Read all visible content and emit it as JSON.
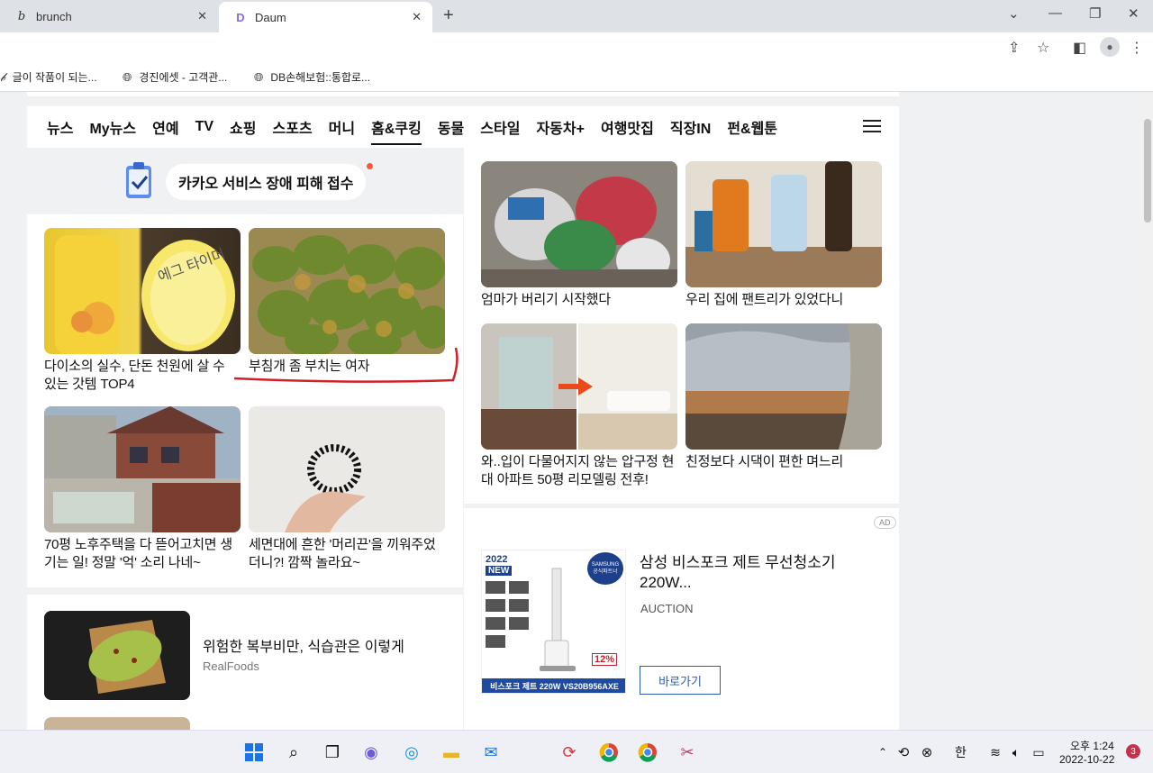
{
  "browser": {
    "tabs": [
      {
        "title": "brunch",
        "favicon": "b"
      },
      {
        "title": "Daum",
        "favicon": "D"
      }
    ],
    "bookmarks": [
      {
        "label": "글이 작품이 되는..."
      },
      {
        "label": "경진에셋 - 고객관..."
      },
      {
        "label": "DB손해보험::통합로..."
      }
    ]
  },
  "nav": {
    "items": [
      "뉴스",
      "My뉴스",
      "연예",
      "TV",
      "쇼핑",
      "스포츠",
      "머니",
      "홈&쿠킹",
      "동물",
      "스타일",
      "자동차+",
      "여행맛집",
      "직장IN",
      "펀&웹툰"
    ],
    "active": "홈&쿠킹"
  },
  "banner": {
    "label": "카카오 서비스 장애 피해 접수"
  },
  "left_cards": [
    {
      "caption": "다이소의 실수, 단돈 천원에 살 수 있는 갓템 TOP4",
      "thumb_text": "에그 타이머"
    },
    {
      "caption": "부침개 좀 부치는 여자"
    },
    {
      "caption": "70평 노후주택을 다 뜯어고치면 생기는 일! 정말 '억' 소리 나네~"
    },
    {
      "caption": "세면대에 흔한 '머리끈'을 끼워주었더니?! 깜짝 놀라요~"
    }
  ],
  "right_cards": [
    {
      "caption": "엄마가 버리기 시작했다"
    },
    {
      "caption": "우리 집에 팬트리가 있었다니"
    },
    {
      "caption": "와..입이 다물어지지 않는 압구정 현대 아파트 50평 리모델링 전후!"
    },
    {
      "caption": "친정보다 시댁이 편한 며느리"
    }
  ],
  "ad": {
    "badge": "AD",
    "title": "삼성 비스포크 제트 무선청소기 220W...",
    "source": "AUCTION",
    "button": "바로가기",
    "img_year": "2022",
    "img_new": "NEW",
    "img_brand": "SAMSUNG",
    "img_partner": "공식파트너",
    "img_discount": "12%",
    "img_footer": "비스포크 제트 220W VS20B956AXE"
  },
  "news": {
    "title": "위험한 복부비만, 식습관은 이렇게",
    "source": "RealFoods"
  },
  "taskbar": {
    "ime": "한",
    "time": "오후 1:24",
    "date": "2022-10-22",
    "notifications": "3"
  },
  "colors": {
    "accent_red": "#d0202a",
    "link_blue": "#2b5ea8"
  }
}
